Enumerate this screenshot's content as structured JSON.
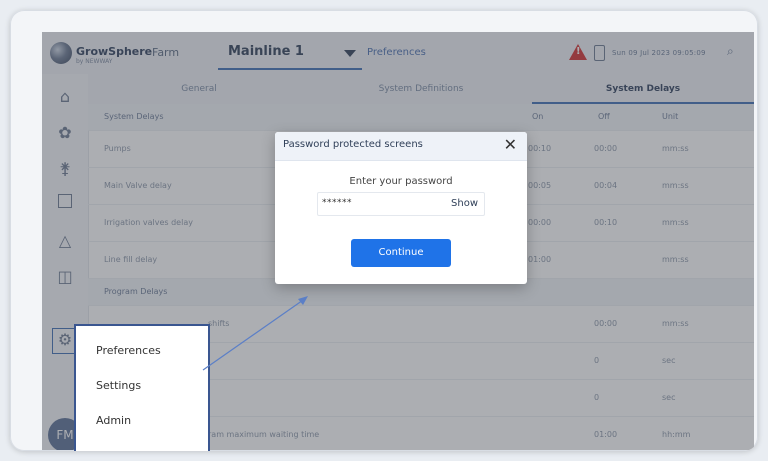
{
  "app": {
    "name": "GrowSphere",
    "byline": "by NEWWAY",
    "farm_label": "Farm"
  },
  "header": {
    "mainline": "Mainline 1",
    "preferences_link": "Preferences",
    "datetime": "Sun 09 Jul 2023   09:05:09"
  },
  "tabs": [
    {
      "label": "General"
    },
    {
      "label": "System Definitions"
    },
    {
      "label": "System Delays",
      "active": true
    }
  ],
  "table": {
    "columns": [
      "On",
      "Off",
      "Unit"
    ],
    "section1": "System Delays",
    "rows": [
      {
        "name": "Pumps",
        "on": "00:10",
        "off": "00:00",
        "unit": "mm:ss"
      },
      {
        "name": "Main Valve delay",
        "on": "00:05",
        "off": "00:04",
        "unit": "mm:ss"
      },
      {
        "name": "Irrigation valves delay",
        "on": "00:00",
        "off": "00:10",
        "unit": "mm:ss"
      },
      {
        "name": "Line fill delay",
        "on": "01:00",
        "off": "",
        "unit": "mm:ss"
      }
    ],
    "section2": "Program Delays",
    "program_rows": [
      {
        "name": "shifts",
        "off": "00:00",
        "unit": "mm:ss"
      },
      {
        "name": "",
        "off": "0",
        "unit": "sec"
      },
      {
        "name": "",
        "off": "0",
        "unit": "sec"
      },
      {
        "name": "ram maximum waiting time",
        "off": "01:00",
        "unit": "hh:mm"
      }
    ]
  },
  "modal": {
    "title": "Password protected screens",
    "close": "✕",
    "prompt": "Enter your password",
    "password_value": "******",
    "show_label": "Show",
    "continue_label": "Continue"
  },
  "menu": {
    "items": [
      "Preferences",
      "Settings",
      "Admin"
    ]
  },
  "user": {
    "initials": "FM"
  },
  "icons": {
    "home": "home-icon",
    "plant": "plant-icon",
    "fert": "fertilizer-icon",
    "eto": "eto-icon",
    "alarm": "alarm-icon",
    "layout": "layout-icon",
    "gear": "gear-icon"
  },
  "colors": {
    "accent": "#1f73e8",
    "alarm": "#d32f2f",
    "highlight": "#3a5690"
  }
}
